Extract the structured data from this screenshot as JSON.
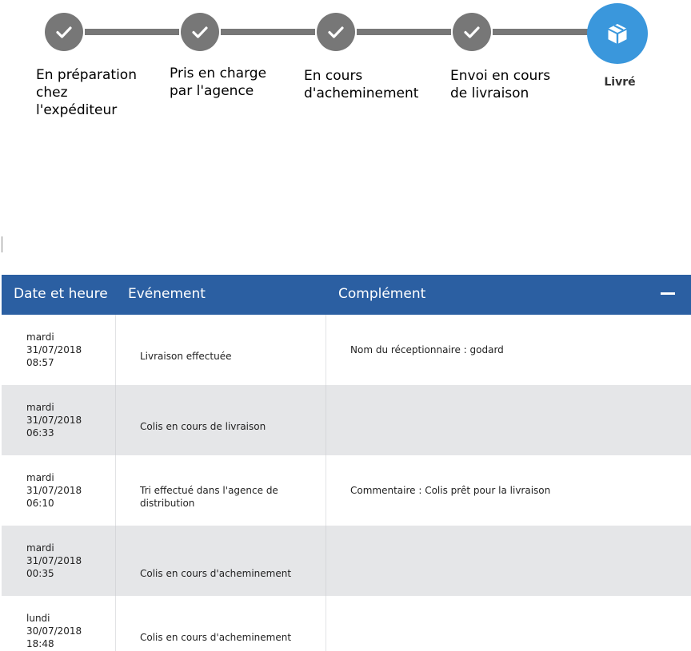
{
  "tracker": {
    "steps": [
      {
        "label": "En préparation\nchez\nl'expéditeur",
        "state": "done",
        "icon": "check-icon"
      },
      {
        "label": "Pris en charge\npar l'agence",
        "state": "done",
        "icon": "check-icon"
      },
      {
        "label": "En cours\nd'acheminement",
        "state": "done",
        "icon": "check-icon"
      },
      {
        "label": "Envoi en cours\nde livraison",
        "state": "done",
        "icon": "check-icon"
      },
      {
        "label": "Livré",
        "state": "current",
        "icon": "package-icon"
      }
    ],
    "colors": {
      "done": "#777777",
      "current": "#3a97dc"
    }
  },
  "table": {
    "headers": {
      "date": "Date et heure",
      "event": "Evénement",
      "extra": "Complément"
    },
    "collapse_icon": "minus-icon",
    "header_color": "#2b5fa2",
    "rows": [
      {
        "date": "mardi\n31/07/2018\n08:57",
        "event": "Livraison effectuée",
        "extra": "Nom du réceptionnaire : godard"
      },
      {
        "date": "mardi\n31/07/2018\n06:33",
        "event": "Colis en cours de livraison",
        "extra": ""
      },
      {
        "date": "mardi\n31/07/2018\n06:10",
        "event": "Tri effectué dans l'agence de\ndistribution",
        "extra": "Commentaire : Colis prêt pour la livraison"
      },
      {
        "date": "mardi\n31/07/2018\n00:35",
        "event": "Colis en cours d'acheminement",
        "extra": ""
      },
      {
        "date": "lundi\n30/07/2018\n18:48",
        "event": "Colis en cours d'acheminement",
        "extra": ""
      }
    ]
  }
}
